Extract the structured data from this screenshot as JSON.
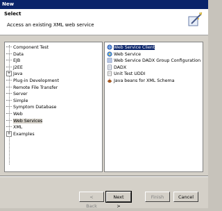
{
  "window": {
    "title": "New"
  },
  "banner": {
    "title": "Select",
    "description": "Access an existing XML web service"
  },
  "tree": {
    "items": [
      {
        "label": "Component Test",
        "expandable": false
      },
      {
        "label": "Data",
        "expandable": false
      },
      {
        "label": "EJB",
        "expandable": false
      },
      {
        "label": "J2EE",
        "expandable": false
      },
      {
        "label": "Java",
        "expandable": true
      },
      {
        "label": "Plug-in Development",
        "expandable": false
      },
      {
        "label": "Remote File Transfer",
        "expandable": false
      },
      {
        "label": "Server",
        "expandable": false
      },
      {
        "label": "Simple",
        "expandable": false
      },
      {
        "label": "Symptom Database",
        "expandable": false
      },
      {
        "label": "Web",
        "expandable": false
      },
      {
        "label": "Web Services",
        "expandable": false,
        "selected": true
      },
      {
        "label": "XML",
        "expandable": false
      },
      {
        "label": "Examples",
        "expandable": true
      }
    ]
  },
  "list": {
    "items": [
      {
        "label": "Web Service Client",
        "icon": "web-service-client-icon",
        "selected": true
      },
      {
        "label": "Web Service",
        "icon": "web-service-icon"
      },
      {
        "label": "Web Service DADX Group Configuration",
        "icon": "dadx-group-icon"
      },
      {
        "label": "DADX",
        "icon": "dadx-icon"
      },
      {
        "label": "Unit Test UDDI",
        "icon": "uddi-icon"
      },
      {
        "label": "Java beans for XML Schema",
        "icon": "java-bean-icon"
      }
    ]
  },
  "buttons": {
    "back": "< Back",
    "next": "Next >",
    "finish": "Finish",
    "cancel": "Cancel"
  }
}
